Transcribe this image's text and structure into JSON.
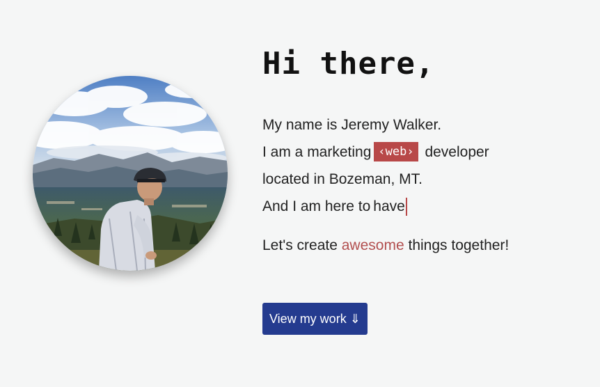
{
  "hero": {
    "greeting": "Hi there,",
    "intro": {
      "line1": "My name is Jeremy Walker.",
      "line2_before": "I am a marketing",
      "line2_tag": "‹web›",
      "line2_after": "developer",
      "line3": "located in Bozeman, MT.",
      "line4_before": "And I am here to",
      "line4_typed": "have"
    },
    "tagline": {
      "before": "Let's create",
      "accent": "awesome",
      "after": "things together!"
    },
    "cta_label": "View my work ⇓"
  },
  "colors": {
    "background": "#f5f6f6",
    "accent": "#b84848",
    "button": "#243b8f"
  }
}
